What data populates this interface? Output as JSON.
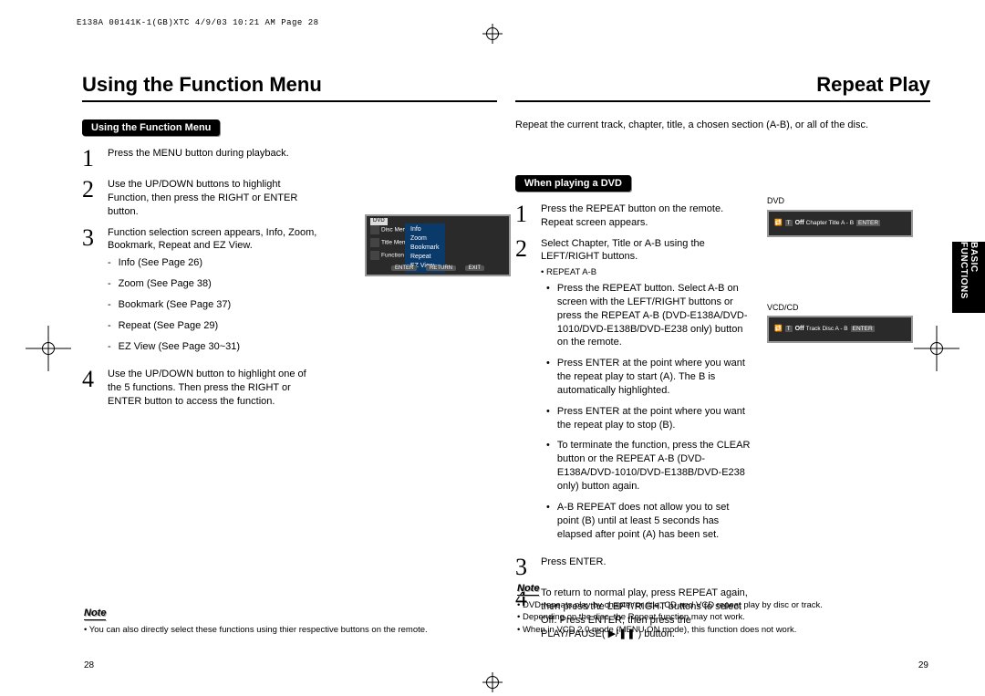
{
  "header_print": "E138A 00141K-1(GB)XTC  4/9/03 10:21 AM  Page 28",
  "side_tab": "BASIC FUNCTIONS",
  "left": {
    "title": "Using the Function Menu",
    "tag": "Using the Function Menu",
    "steps": [
      {
        "n": "1",
        "t": "Press the MENU button during playback."
      },
      {
        "n": "2",
        "t": "Use the UP/DOWN buttons to highlight Function, then press the RIGHT or ENTER button."
      },
      {
        "n": "3",
        "t": "Function selection screen appears, Info, Zoom, Bookmark, Repeat and EZ View.",
        "sub": [
          "Info (See Page 26)",
          "Zoom (See Page 38)",
          "Bookmark (See Page 37)",
          "Repeat (See Page 29)",
          "EZ View (See Page 30~31)"
        ]
      },
      {
        "n": "4",
        "t": "Use the UP/DOWN button to highlight one of the 5 functions. Then press the RIGHT or ENTER button to access the function."
      }
    ],
    "note_title": "Note",
    "notes": [
      "You can also directly select these functions using thier respective buttons on the remote."
    ],
    "page": "28",
    "osd_menu": [
      "Info",
      "Zoom",
      "Bookmark",
      "Repeat",
      "EZ View"
    ],
    "osd_left": [
      "Disc Menu",
      "Title Menu",
      "Function"
    ],
    "osd_dvd": "DVD",
    "osd_bottom": [
      "ENTER",
      "RETURN",
      "EXIT"
    ]
  },
  "right": {
    "title": "Repeat Play",
    "intro": "Repeat the current track, chapter, title, a chosen section (A-B), or all of the disc.",
    "tag": "When playing a DVD",
    "steps": [
      {
        "n": "1",
        "t": "Press the REPEAT button on the remote. Repeat screen appears."
      },
      {
        "n": "2",
        "t": "Select Chapter, Title or A-B using the LEFT/RIGHT buttons.",
        "sub_title": "REPEAT A-B",
        "sub": [
          "Press the REPEAT button. Select A-B on screen with the LEFT/RIGHT buttons or press the REPEAT A-B (DVD-E138A/DVD-1010/DVD-E138B/DVD-E238 only) button on the remote.",
          "Press ENTER at the point where you want the repeat play to start (A). The B is automatically highlighted.",
          "Press ENTER at the point where you want the repeat play to stop (B).",
          "To terminate the function, press the CLEAR button or the REPEAT A-B (DVD-E138A/DVD-1010/DVD-E138B/DVD-E238 only) button again.",
          "A-B REPEAT does not allow you to set point (B) until at least 5 seconds has elapsed after point (A) has been set."
        ]
      },
      {
        "n": "3",
        "t": "Press ENTER."
      },
      {
        "n": "4",
        "t": "To return to normal play, press REPEAT again, then press the LEFT/RIGHT buttons to select Off. Press ENTER, then press the PLAY/PAUSE( ▶/❚❚ ) button."
      }
    ],
    "note_title": "Note",
    "notes": [
      "DVD repeats play by chapter or title, CD and VCD repeat play by disc or track.",
      "Depending on the disc, the Repeat function may not work.",
      "When in VCD 2.0 mode (MENU ON mode), this function does not work."
    ],
    "page": "29",
    "osd_dvd_label": "DVD",
    "osd_vcd_label": "VCD/CD",
    "osd_dvd_line": "Off  Chapter  Title  A - B",
    "osd_vcd_line": "Off  Track  Disc  A - B"
  }
}
